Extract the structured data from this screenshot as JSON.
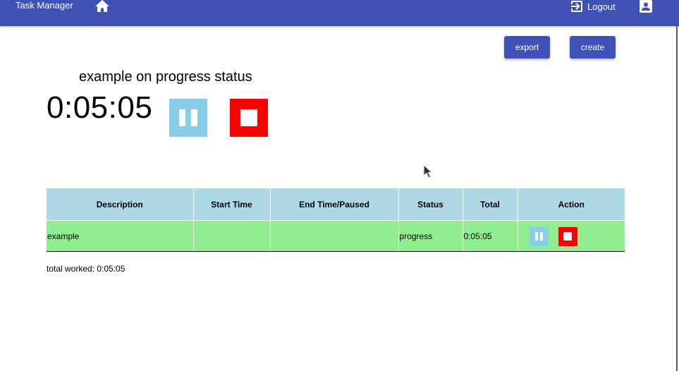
{
  "appbar": {
    "title": "Task Manager",
    "logout_label": "Logout",
    "color": "#3f51b5"
  },
  "toolbar": {
    "export_label": "export",
    "create_label": "create"
  },
  "current_task": {
    "heading": "example on progress status",
    "timer": "0:05:05",
    "pause_color": "#87ceeb",
    "stop_color": "#ff0000"
  },
  "table": {
    "headers": [
      "Description",
      "Start Time",
      "End Time/Paused",
      "Status",
      "Total",
      "Action"
    ],
    "rows": [
      {
        "description": "example",
        "start_time": "",
        "end_time": "",
        "status": "progress",
        "total": "0:05:05"
      }
    ],
    "header_color": "#add8e6",
    "row_color": "#90ee90"
  },
  "summary": {
    "total_worked": "total worked: 0:05:05"
  },
  "icons": [
    "home-icon",
    "logout-icon",
    "account-icon",
    "pause-icon",
    "stop-icon",
    "mouse-cursor-icon"
  ]
}
